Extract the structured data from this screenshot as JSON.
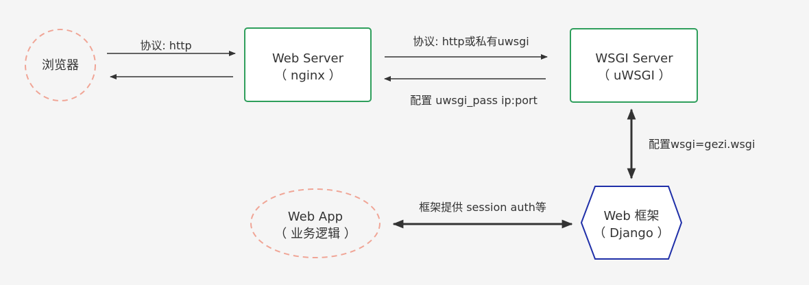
{
  "nodes": {
    "browser": {
      "label": "浏览器"
    },
    "web_server": {
      "line1": "Web Server",
      "line2": "（ nginx ）"
    },
    "wsgi_server": {
      "line1": "WSGI Server",
      "line2": "（ uWSGI ）"
    },
    "web_framework": {
      "line1": "Web 框架",
      "line2": "（ Django ）"
    },
    "web_app": {
      "line1": "Web App",
      "line2": "（ 业务逻辑 ）"
    }
  },
  "edges": {
    "browser_to_server": "协议: http",
    "server_to_wsgi": "协议: http或私有uwsgi",
    "server_wsgi_config": "配置 uwsgi_pass ip:port",
    "wsgi_framework_config": "配置wsgi=gezi.wsgi",
    "framework_app": "框架提供 session auth等"
  },
  "colors": {
    "box_border": "#2e9e5b",
    "dashed_circle": "#f0a596",
    "hexagon_border": "#1f2fa8",
    "arrow": "#333333",
    "background": "#f5f5f5"
  }
}
